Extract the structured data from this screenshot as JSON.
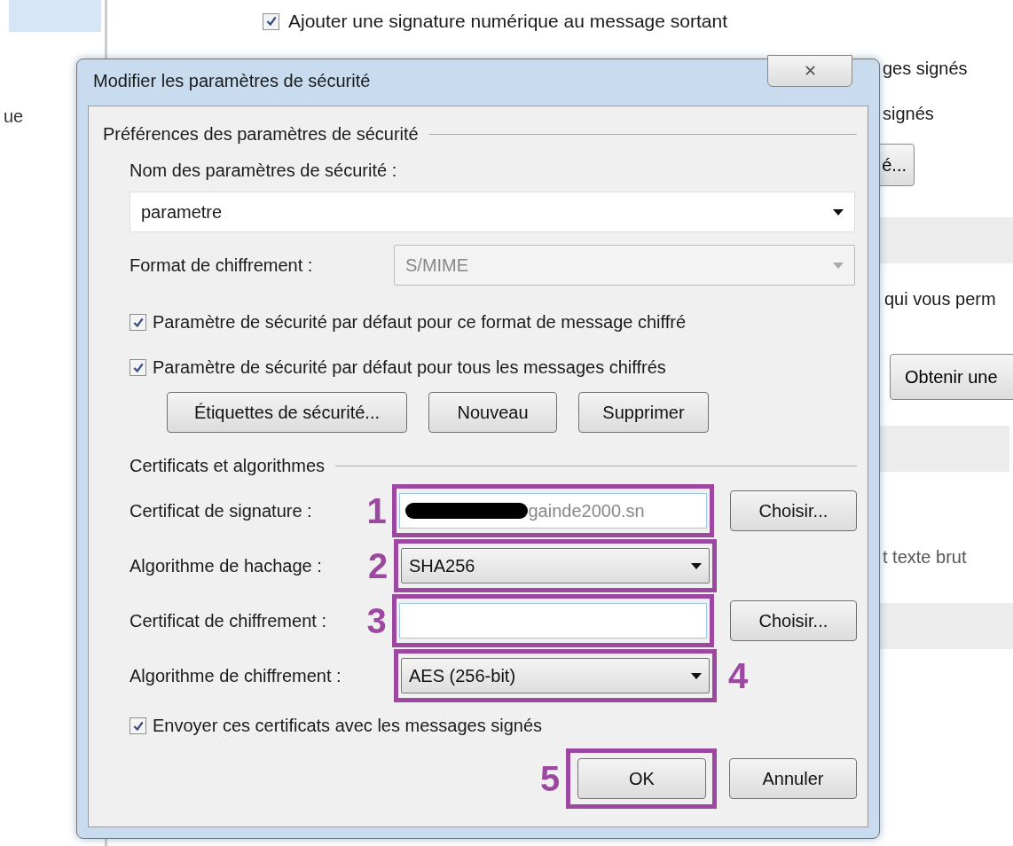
{
  "background_window": {
    "sidebar_items": [
      {
        "label": "ue",
        "selected": false
      }
    ],
    "top_option": {
      "label": "Ajouter une signature numérique au message sortant",
      "checked": true
    },
    "right_texts": [
      "ges signés",
      "signés"
    ],
    "right_button": "é...",
    "right_text_2": "qui vous perm",
    "right_button_2": "Obtenir une",
    "right_text_3": "t texte brut"
  },
  "dialog": {
    "title": "Modifier les paramètres de sécurité",
    "close": "✕",
    "group_1": {
      "title": "Préférences des paramètres de sécurité",
      "name_label": "Nom des paramètres de sécurité :",
      "name_value": "parametre",
      "format_label": "Format de chiffrement :",
      "format_value": "S/MIME",
      "format_disabled": true,
      "checkboxes": [
        {
          "label": "Paramètre de sécurité par défaut pour ce format de message chiffré",
          "checked": true
        },
        {
          "label": "Paramètre de sécurité par défaut pour tous les messages chiffrés",
          "checked": true
        }
      ],
      "buttons": [
        "Étiquettes de sécurité...",
        "Nouveau",
        "Supprimer"
      ]
    },
    "group_2": {
      "title": "Certificats et algorithmes",
      "rows": [
        {
          "kind": "certificate",
          "label": "Certificat de signature :",
          "value": "gainde2000.sn",
          "redacted": true,
          "button": "Choisir...",
          "annotation": "1"
        },
        {
          "kind": "select",
          "label": "Algorithme de hachage :",
          "value": "SHA256",
          "annotation": "2"
        },
        {
          "kind": "certificate",
          "label": "Certificat de chiffrement :",
          "value": "",
          "redacted": false,
          "button": "Choisir...",
          "annotation": "3"
        },
        {
          "kind": "select",
          "label": "Algorithme de chiffrement :",
          "value": "AES (256-bit)",
          "annotation": "4"
        }
      ],
      "send_certificates": {
        "label": "Envoyer ces certificats avec les messages signés",
        "checked": true
      }
    },
    "ok": {
      "label": "OK",
      "annotation": "5"
    },
    "cancel": "Annuler"
  }
}
